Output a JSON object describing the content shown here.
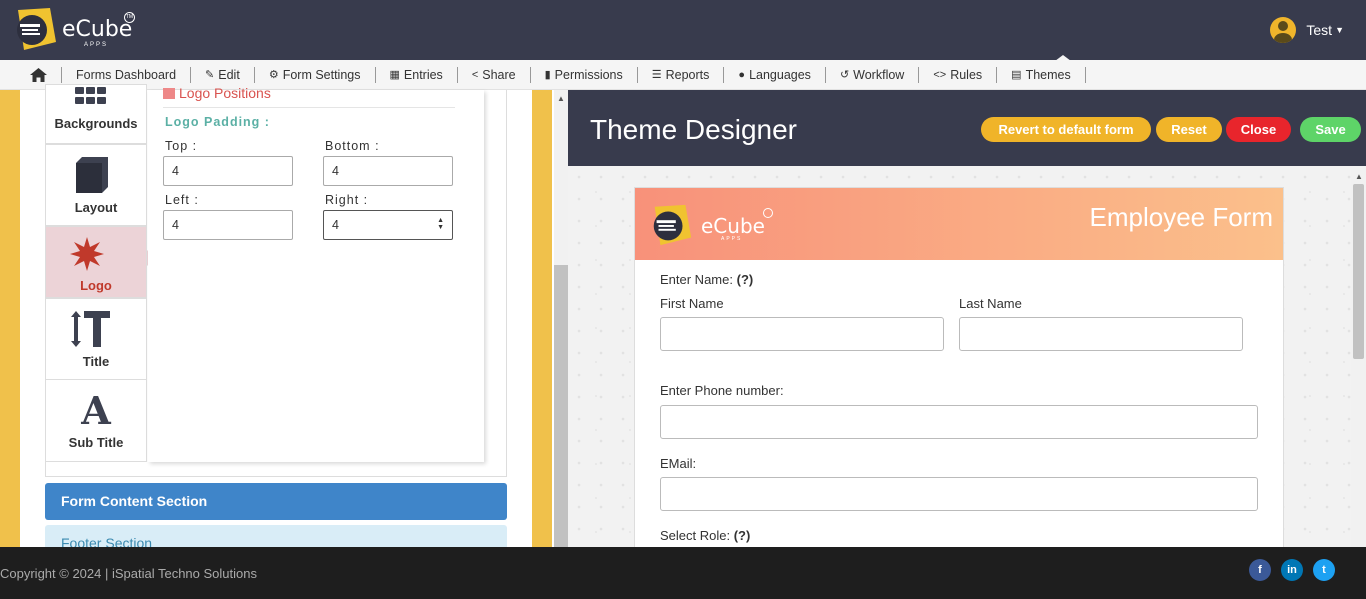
{
  "header": {
    "brand": "eCube",
    "brand_sub": "APPS",
    "brand_tm": "TM",
    "user_name": "Test"
  },
  "nav": {
    "items": [
      {
        "label": "Forms Dashboard",
        "icon": "none"
      },
      {
        "label": "Edit",
        "icon": "edit-icon"
      },
      {
        "label": "Form Settings",
        "icon": "gear-icon"
      },
      {
        "label": "Entries",
        "icon": "table-icon"
      },
      {
        "label": "Share",
        "icon": "share-icon"
      },
      {
        "label": "Permissions",
        "icon": "lock-icon"
      },
      {
        "label": "Reports",
        "icon": "database-icon"
      },
      {
        "label": "Languages",
        "icon": "language-icon"
      },
      {
        "label": "Workflow",
        "icon": "retweet-icon"
      },
      {
        "label": "Rules",
        "icon": "code-icon"
      },
      {
        "label": "Themes",
        "icon": "newspaper-icon",
        "active": true
      }
    ]
  },
  "left": {
    "tabs": [
      {
        "label": "Backgrounds"
      },
      {
        "label": "Layout"
      },
      {
        "label": "Logo",
        "active": true
      },
      {
        "label": "Title"
      },
      {
        "label": "Sub Title"
      }
    ],
    "logo_panel": {
      "section_title": "Logo Positions",
      "padding_title": "Logo Padding :",
      "top_label": "Top :",
      "top_value": "4",
      "bottom_label": "Bottom :",
      "bottom_value": "4",
      "left_label": "Left :",
      "left_value": "4",
      "right_label": "Right :",
      "right_value": "4"
    },
    "sections": {
      "content": "Form Content Section",
      "footer": "Footer Section"
    }
  },
  "designer": {
    "title": "Theme Designer",
    "revert_label": "Revert to default form",
    "reset_label": "Reset",
    "close_label": "Close",
    "save_label": "Save",
    "colors": {
      "revert": "#f0b429",
      "reset": "#f0b429",
      "close": "#e8252c",
      "save": "#5ed468"
    }
  },
  "form": {
    "brand": "eCube",
    "brand_sub": "APPS",
    "title": "Employee Form",
    "name_label": "Enter Name:",
    "help": "(?)",
    "first_name": "First Name",
    "last_name": "Last Name",
    "phone_label": "Enter Phone number:",
    "email_label": "EMail:",
    "role_label": "Select Role:",
    "role_help": "(?)"
  },
  "footer": {
    "copyright": "Copyright © 2024 | iSpatial Techno Solutions",
    "social": [
      "f",
      "in",
      "t"
    ]
  }
}
